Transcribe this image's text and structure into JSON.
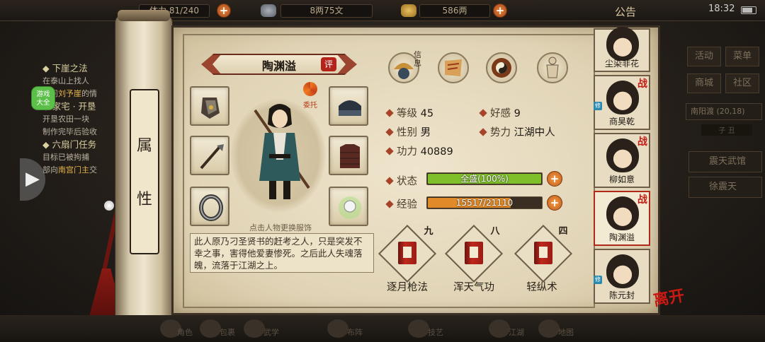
{
  "topbar": {
    "stamina_label": "体力",
    "stamina": "81/240",
    "silver": "8两75文",
    "gold": "586两",
    "announcement": "公告",
    "time": "18:32"
  },
  "quest": {
    "items": [
      {
        "title": "下崖之法",
        "lines": [
          "在泰山上找人",
          "询问",
          "刘予崖",
          "的情"
        ]
      },
      {
        "title": "家宅 · 开垦",
        "lines": [
          "开垦农田一块",
          "制作完毕后验收"
        ]
      },
      {
        "title": "六扇门任务",
        "lines": [
          "目标已被拘捕",
          "部向",
          "南宫门主",
          "交"
        ]
      }
    ],
    "game_box": "游戏\n大全"
  },
  "scroll": {
    "tab_label_1": "属",
    "tab_label_2": "性"
  },
  "character": {
    "name": "陶渊溢",
    "rate_label": "评",
    "delegate_label": "委托",
    "change_hint": "点击人物更换服饰",
    "description": "此人原乃刁圣贤书的赶考之人，只是突发不幸之事，害得他爱妻惨死。之后此人失魂落魄，流落于江湖之上。",
    "info_tag": "信息"
  },
  "stats": {
    "level_label": "等级",
    "level": "45",
    "favor_label": "好感",
    "favor": "9",
    "gender_label": "性别",
    "gender": "男",
    "faction_label": "势力",
    "faction": "江湖中人",
    "power_label": "功力",
    "power": "40889",
    "status_label": "状态",
    "status_value": "全盛(100%)",
    "status_fraction": 1.0,
    "exp_label": "经验",
    "exp_value": "15517/21110",
    "exp_fraction": 0.735
  },
  "skills": [
    {
      "level": "九",
      "name": "逐月枪法"
    },
    {
      "level": "八",
      "name": "浑天气功"
    },
    {
      "level": "四",
      "name": "轻纵术"
    }
  ],
  "roster": [
    {
      "name": "尘染非花",
      "battle": ""
    },
    {
      "name": "商昊乾",
      "battle": "战"
    },
    {
      "name": "柳如意",
      "battle": "战"
    },
    {
      "name": "陶渊溢",
      "battle": "战"
    },
    {
      "name": "陈元封",
      "battle": ""
    }
  ],
  "close_label": "离开",
  "right_menu": {
    "buttons": [
      "活动",
      "菜单",
      "商城",
      "社区"
    ],
    "location": "南阳渡",
    "coords": "(20,18)",
    "clock": "子  丑",
    "channels": [
      "震天武馆",
      "徐震天"
    ]
  },
  "bottom": [
    "角色",
    "包裹",
    "武学",
    "门派",
    "布阵",
    "技艺",
    "江湖",
    "地图"
  ],
  "colors": {
    "status_bar": "#7fbf2a",
    "exp_bar": "#e08a2a",
    "accent_red": "#b02a1c"
  }
}
